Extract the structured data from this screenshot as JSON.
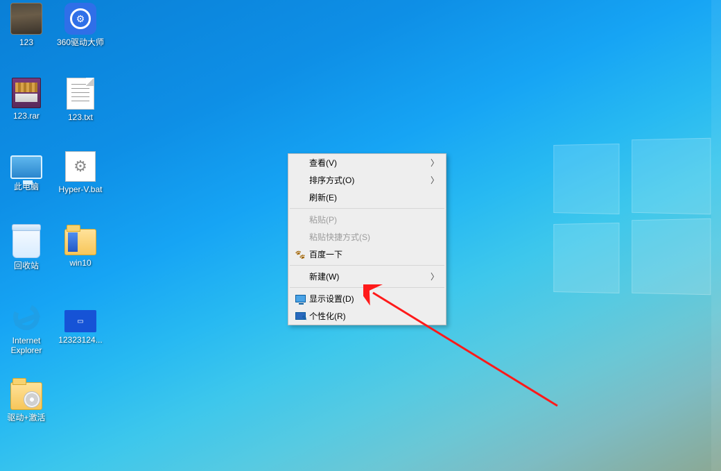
{
  "desktop_icons": {
    "c0r0": "123",
    "c1r0": "360驱动大师",
    "c0r1": "123.rar",
    "c1r1": "123.txt",
    "c0r2": "此电脑",
    "c1r2": "Hyper-V.bat",
    "c0r3": "回收站",
    "c1r3": "win10",
    "c0r4": "Internet\nExplorer",
    "c1r4": "12323124...",
    "c0r5": "驱动+激活"
  },
  "context_menu": {
    "view": "查看(V)",
    "sort": "排序方式(O)",
    "refresh": "刷新(E)",
    "paste": "粘贴(P)",
    "paste_shortcut": "粘贴快捷方式(S)",
    "baidu": "百度一下",
    "new": "新建(W)",
    "display_settings": "显示设置(D)",
    "personalize": "个性化(R)"
  }
}
